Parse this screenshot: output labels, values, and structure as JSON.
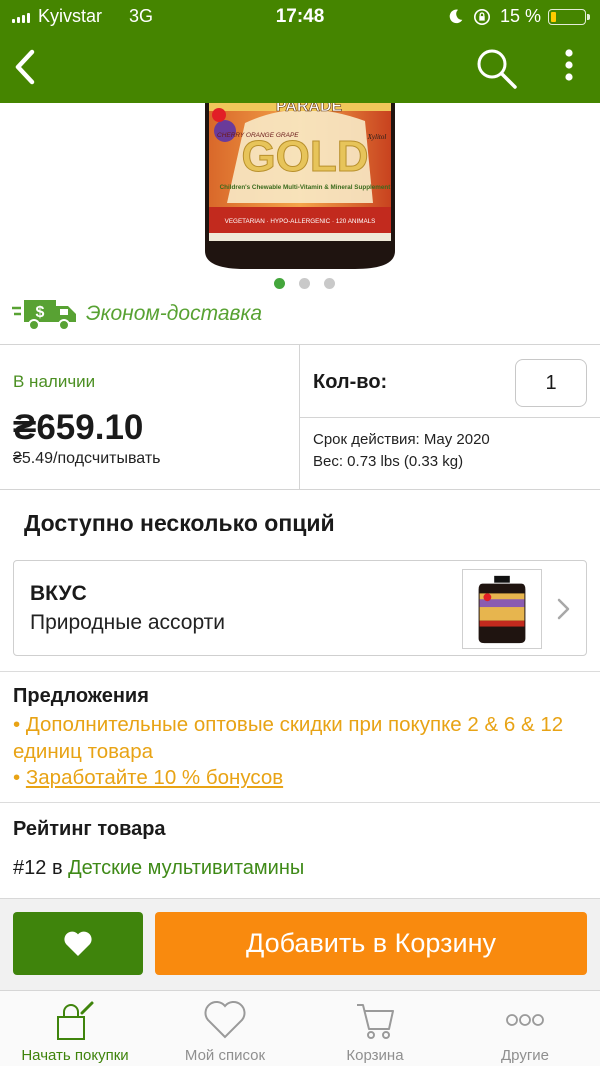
{
  "status_bar": {
    "carrier": "Kyivstar",
    "network": "3G",
    "time": "17:48",
    "battery": "15 %",
    "battery_level": 0.15
  },
  "app_bar": {
    "back_icon": "chevron-left-icon",
    "search_icon": "search-icon",
    "more_icon": "more-vertical-icon",
    "background": "#458500"
  },
  "product_image": {
    "brand_text": "PARADE",
    "gold_text": "GOLD",
    "flavors_text": "CHERRY ORANGE GRAPE",
    "description_text": "Children's Chewable Multi-Vitamin & Mineral Supplement",
    "band_text": "VEGETARIAN · HYPO-ALLERGENIC · 120 ANIMALS",
    "brand_mark": "Xylitol"
  },
  "carousel": {
    "total": 3,
    "active": 1
  },
  "delivery": {
    "icon": "delivery-truck-icon",
    "label": "Эконом-доставка"
  },
  "pricing": {
    "stock": "В наличии",
    "price": "₴659.10",
    "unit_price": "₴5.49/подсчитывать"
  },
  "quantity": {
    "label": "Кол-во:",
    "value": "1"
  },
  "details": {
    "expiry": "Срок действия: May 2020",
    "weight": "Вес: 0.73 lbs (0.33 kg)"
  },
  "options": {
    "title": "Доступно несколько опций",
    "flavor_label": "ВКУС",
    "flavor_value": "Природные ассорти"
  },
  "offers": {
    "title": "Предложения",
    "bullet": "•",
    "offer_1": "Дополнительные оптовые скидки при покупке 2 & 6 & 12 единиц товара",
    "offer_2": "Заработайте 10 % бонусов"
  },
  "rating": {
    "title": "Рейтинг товара",
    "rank": "#12",
    "in": "в",
    "category": "Детские мультивитамины"
  },
  "actions": {
    "wishlist_icon": "heart-icon",
    "add_to_cart": "Добавить в Корзину",
    "wishlist_color": "#3f840c",
    "cart_color": "#f98a0e"
  },
  "tabs": [
    {
      "label": "Начать покупки",
      "icon": "shopping-bag-icon",
      "active": true
    },
    {
      "label": "Мой список",
      "icon": "heart-outline-icon",
      "active": false
    },
    {
      "label": "Корзина",
      "icon": "cart-icon",
      "active": false
    },
    {
      "label": "Другие",
      "icon": "more-horizontal-icon",
      "active": false
    }
  ],
  "colors": {
    "accent_green": "#458500",
    "link_green": "#3f8a18",
    "offer_orange": "#e8a315"
  }
}
